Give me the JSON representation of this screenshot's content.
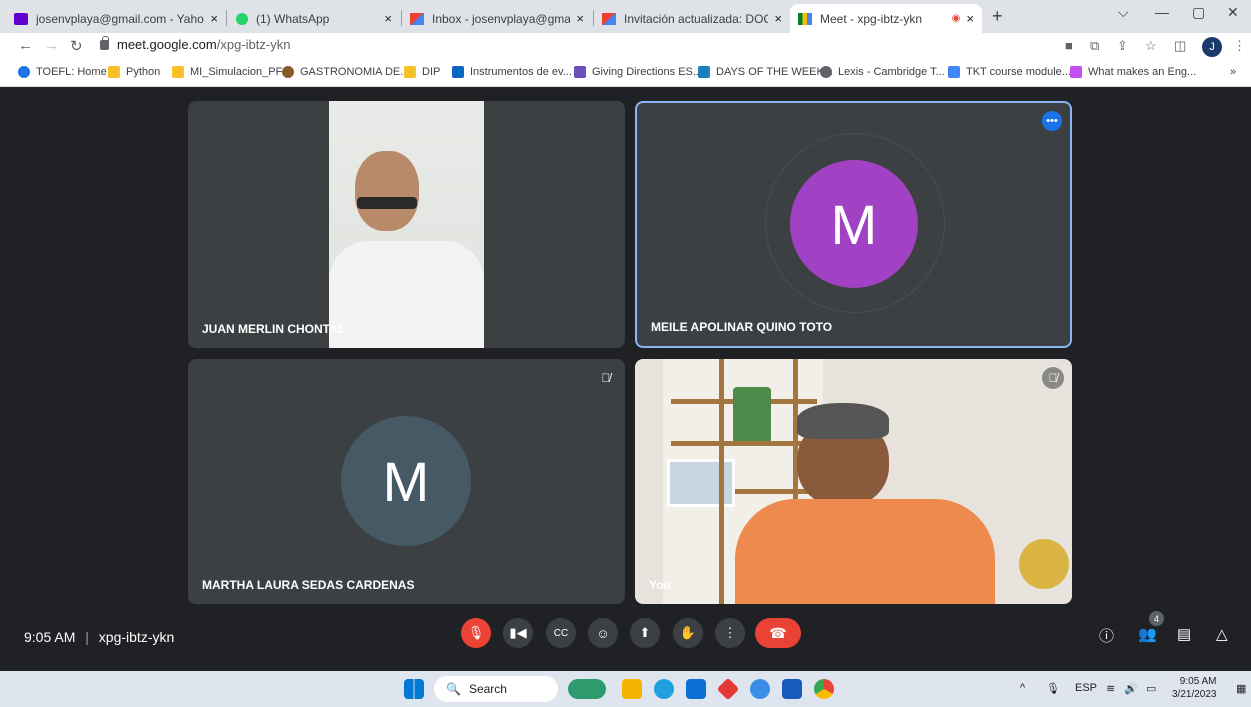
{
  "browser": {
    "tabs": [
      {
        "title": "josenvplaya@gmail.com - Yahoo",
        "color": "#6001d2"
      },
      {
        "title": "(1) WhatsApp",
        "color": "#25d366"
      },
      {
        "title": "Inbox - josenvplaya@gmail.com",
        "color": "#ea4335"
      },
      {
        "title": "Invitación actualizada: DOCENTE",
        "color": "#ea4335"
      },
      {
        "title": "Meet - xpg-ibtz-ykn",
        "color": "#00832d"
      }
    ],
    "close_glyph": "×",
    "new_tab_glyph": "+",
    "url_host": "meet.google.com",
    "url_path": "/xpg-ibtz-ykn",
    "profile_initial": "J",
    "bookmarks": [
      {
        "label": "TOEFL: Home",
        "color": "#1a73e8"
      },
      {
        "label": "Python",
        "color": "#f6c026"
      },
      {
        "label": "MI_Simulacion_PF",
        "color": "#f6c026"
      },
      {
        "label": "GASTRONOMIA DE...",
        "color": "#8b5a2b"
      },
      {
        "label": "DIP",
        "color": "#f6c026"
      },
      {
        "label": "Instrumentos de ev...",
        "color": "#0a66c2"
      },
      {
        "label": "Giving Directions ES...",
        "color": "#6b4fbb"
      },
      {
        "label": "DAYS OF THE WEEK...",
        "color": "#1e7fb8"
      },
      {
        "label": "Lexis - Cambridge T...",
        "color": "#5f6368"
      },
      {
        "label": "TKT course module...",
        "color": "#4285f4"
      },
      {
        "label": "What makes an Eng...",
        "color": "#c34ef0"
      }
    ],
    "bookmarks_overflow": "»"
  },
  "meet": {
    "participants": [
      {
        "name": "JUAN MERLIN CHONTAL",
        "initial": "",
        "avatar_color": ""
      },
      {
        "name": "MEILE APOLINAR QUINO TOTO",
        "initial": "M",
        "avatar_color": "#a142c4"
      },
      {
        "name": "MARTHA LAURA SEDAS CARDENAS",
        "initial": "M",
        "avatar_color": "#455a64"
      },
      {
        "name": "You",
        "initial": "",
        "avatar_color": ""
      }
    ],
    "time": "9:05 AM",
    "separator": "|",
    "meeting_code": "xpg-ibtz-ykn",
    "participant_count": "4",
    "accent": "#8ab4f8",
    "mic_off_color": "#ea4335"
  },
  "taskbar": {
    "search_label": "Search",
    "language": "ESP",
    "time": "9:05 AM",
    "date": "3/21/2023"
  }
}
